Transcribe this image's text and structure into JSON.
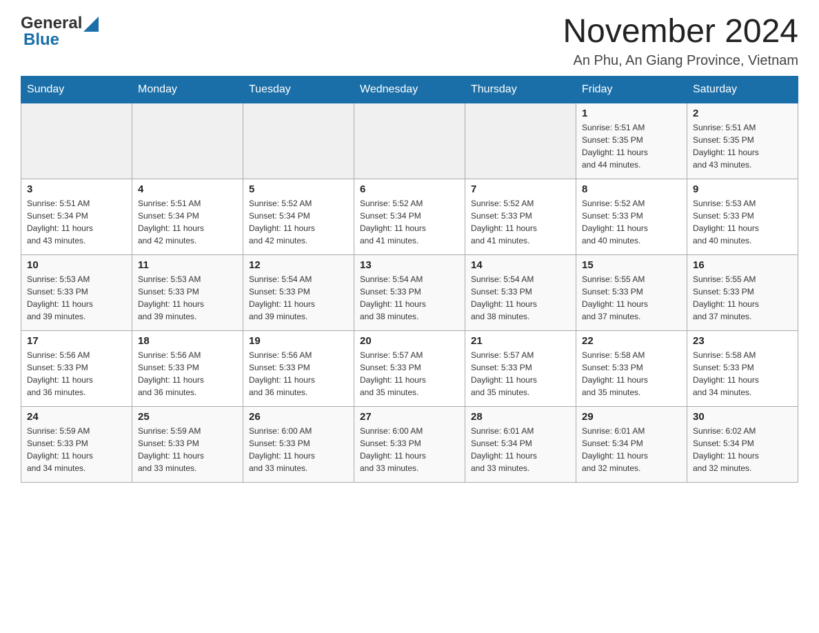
{
  "header": {
    "logo": {
      "text_general": "General",
      "text_blue": "Blue"
    },
    "month_title": "November 2024",
    "location": "An Phu, An Giang Province, Vietnam"
  },
  "calendar": {
    "days_of_week": [
      "Sunday",
      "Monday",
      "Tuesday",
      "Wednesday",
      "Thursday",
      "Friday",
      "Saturday"
    ],
    "weeks": [
      {
        "days": [
          {
            "number": "",
            "info": ""
          },
          {
            "number": "",
            "info": ""
          },
          {
            "number": "",
            "info": ""
          },
          {
            "number": "",
            "info": ""
          },
          {
            "number": "",
            "info": ""
          },
          {
            "number": "1",
            "info": "Sunrise: 5:51 AM\nSunset: 5:35 PM\nDaylight: 11 hours\nand 44 minutes."
          },
          {
            "number": "2",
            "info": "Sunrise: 5:51 AM\nSunset: 5:35 PM\nDaylight: 11 hours\nand 43 minutes."
          }
        ]
      },
      {
        "days": [
          {
            "number": "3",
            "info": "Sunrise: 5:51 AM\nSunset: 5:34 PM\nDaylight: 11 hours\nand 43 minutes."
          },
          {
            "number": "4",
            "info": "Sunrise: 5:51 AM\nSunset: 5:34 PM\nDaylight: 11 hours\nand 42 minutes."
          },
          {
            "number": "5",
            "info": "Sunrise: 5:52 AM\nSunset: 5:34 PM\nDaylight: 11 hours\nand 42 minutes."
          },
          {
            "number": "6",
            "info": "Sunrise: 5:52 AM\nSunset: 5:34 PM\nDaylight: 11 hours\nand 41 minutes."
          },
          {
            "number": "7",
            "info": "Sunrise: 5:52 AM\nSunset: 5:33 PM\nDaylight: 11 hours\nand 41 minutes."
          },
          {
            "number": "8",
            "info": "Sunrise: 5:52 AM\nSunset: 5:33 PM\nDaylight: 11 hours\nand 40 minutes."
          },
          {
            "number": "9",
            "info": "Sunrise: 5:53 AM\nSunset: 5:33 PM\nDaylight: 11 hours\nand 40 minutes."
          }
        ]
      },
      {
        "days": [
          {
            "number": "10",
            "info": "Sunrise: 5:53 AM\nSunset: 5:33 PM\nDaylight: 11 hours\nand 39 minutes."
          },
          {
            "number": "11",
            "info": "Sunrise: 5:53 AM\nSunset: 5:33 PM\nDaylight: 11 hours\nand 39 minutes."
          },
          {
            "number": "12",
            "info": "Sunrise: 5:54 AM\nSunset: 5:33 PM\nDaylight: 11 hours\nand 39 minutes."
          },
          {
            "number": "13",
            "info": "Sunrise: 5:54 AM\nSunset: 5:33 PM\nDaylight: 11 hours\nand 38 minutes."
          },
          {
            "number": "14",
            "info": "Sunrise: 5:54 AM\nSunset: 5:33 PM\nDaylight: 11 hours\nand 38 minutes."
          },
          {
            "number": "15",
            "info": "Sunrise: 5:55 AM\nSunset: 5:33 PM\nDaylight: 11 hours\nand 37 minutes."
          },
          {
            "number": "16",
            "info": "Sunrise: 5:55 AM\nSunset: 5:33 PM\nDaylight: 11 hours\nand 37 minutes."
          }
        ]
      },
      {
        "days": [
          {
            "number": "17",
            "info": "Sunrise: 5:56 AM\nSunset: 5:33 PM\nDaylight: 11 hours\nand 36 minutes."
          },
          {
            "number": "18",
            "info": "Sunrise: 5:56 AM\nSunset: 5:33 PM\nDaylight: 11 hours\nand 36 minutes."
          },
          {
            "number": "19",
            "info": "Sunrise: 5:56 AM\nSunset: 5:33 PM\nDaylight: 11 hours\nand 36 minutes."
          },
          {
            "number": "20",
            "info": "Sunrise: 5:57 AM\nSunset: 5:33 PM\nDaylight: 11 hours\nand 35 minutes."
          },
          {
            "number": "21",
            "info": "Sunrise: 5:57 AM\nSunset: 5:33 PM\nDaylight: 11 hours\nand 35 minutes."
          },
          {
            "number": "22",
            "info": "Sunrise: 5:58 AM\nSunset: 5:33 PM\nDaylight: 11 hours\nand 35 minutes."
          },
          {
            "number": "23",
            "info": "Sunrise: 5:58 AM\nSunset: 5:33 PM\nDaylight: 11 hours\nand 34 minutes."
          }
        ]
      },
      {
        "days": [
          {
            "number": "24",
            "info": "Sunrise: 5:59 AM\nSunset: 5:33 PM\nDaylight: 11 hours\nand 34 minutes."
          },
          {
            "number": "25",
            "info": "Sunrise: 5:59 AM\nSunset: 5:33 PM\nDaylight: 11 hours\nand 33 minutes."
          },
          {
            "number": "26",
            "info": "Sunrise: 6:00 AM\nSunset: 5:33 PM\nDaylight: 11 hours\nand 33 minutes."
          },
          {
            "number": "27",
            "info": "Sunrise: 6:00 AM\nSunset: 5:33 PM\nDaylight: 11 hours\nand 33 minutes."
          },
          {
            "number": "28",
            "info": "Sunrise: 6:01 AM\nSunset: 5:34 PM\nDaylight: 11 hours\nand 33 minutes."
          },
          {
            "number": "29",
            "info": "Sunrise: 6:01 AM\nSunset: 5:34 PM\nDaylight: 11 hours\nand 32 minutes."
          },
          {
            "number": "30",
            "info": "Sunrise: 6:02 AM\nSunset: 5:34 PM\nDaylight: 11 hours\nand 32 minutes."
          }
        ]
      }
    ]
  }
}
